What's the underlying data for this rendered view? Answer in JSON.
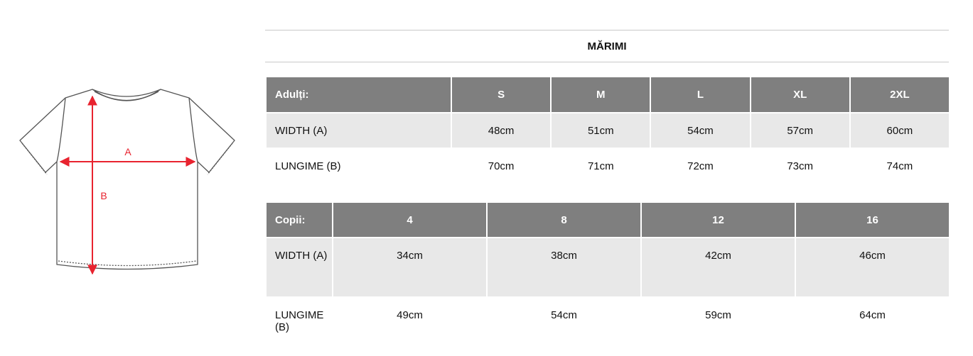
{
  "diagram": {
    "label_a": "A",
    "label_b": "B",
    "arrow_color": "#e8232f",
    "outline_color": "#555555"
  },
  "title": "MĂRIMI",
  "adults": {
    "header": "Adulți:",
    "sizes": [
      "S",
      "M",
      "L",
      "XL",
      "2XL"
    ],
    "rows": [
      {
        "label": "WIDTH (A)",
        "values": [
          "48cm",
          "51cm",
          "54cm",
          "57cm",
          "60cm"
        ]
      },
      {
        "label": "LUNGIME (B)",
        "values": [
          "70cm",
          "71cm",
          "72cm",
          "73cm",
          "74cm"
        ]
      }
    ]
  },
  "kids": {
    "header": "Copii:",
    "sizes": [
      "4",
      "8",
      "12",
      "16"
    ],
    "rows": [
      {
        "label": "WIDTH (A)",
        "values": [
          "34cm",
          "38cm",
          "42cm",
          "46cm"
        ]
      },
      {
        "label": "LUNGIME (B)",
        "values": [
          "49cm",
          "54cm",
          "59cm",
          "64cm"
        ]
      }
    ]
  },
  "colors": {
    "header_bg": "#7f7f7f",
    "row_shade": "#e8e8e8",
    "rule": "#c9c9c9"
  }
}
